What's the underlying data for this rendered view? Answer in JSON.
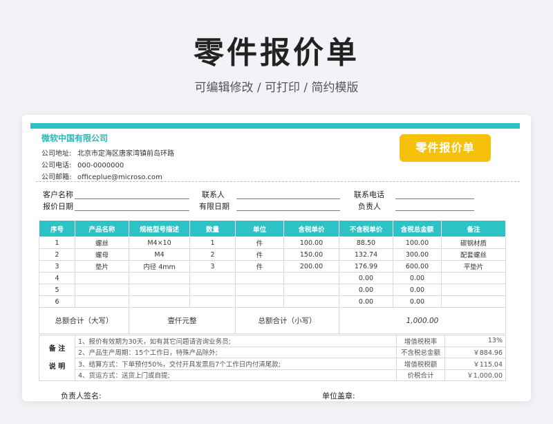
{
  "hero": {
    "title": "零件报价单",
    "subtitle": "可编辑修改 /  可打印  /  简约模版"
  },
  "company": {
    "name": "微软中国有限公司",
    "address_label": "公司地址:",
    "address": "北京市定海区唐家湾镇前岛环路",
    "phone_label": "公司电话:",
    "phone": "000-0000000",
    "email_label": "公司邮箱:",
    "email": "officeplue@microso.com"
  },
  "badge": "零件报价单",
  "fields": {
    "customer": "客户名称",
    "contact": "联系人",
    "contact_phone": "联系电话",
    "quote_date": "报价日期",
    "valid_date": "有限日期",
    "manager": "负责人"
  },
  "table": {
    "headers": [
      "序号",
      "产品名称",
      "规格型号描述",
      "数量",
      "单位",
      "含税单价",
      "不含税单价",
      "含税总金额",
      "备注"
    ],
    "rows": [
      [
        "1",
        "螺丝",
        "M4×10",
        "1",
        "件",
        "100.00",
        "88.50",
        "100.00",
        "碳钢材质"
      ],
      [
        "2",
        "螺母",
        "M4",
        "2",
        "件",
        "150.00",
        "132.74",
        "300.00",
        "配套螺丝"
      ],
      [
        "3",
        "垫片",
        "内径 4mm",
        "3",
        "件",
        "200.00",
        "176.99",
        "600.00",
        "平垫片"
      ],
      [
        "4",
        "",
        "",
        "",
        "",
        "",
        "0.00",
        "0.00",
        ""
      ],
      [
        "5",
        "",
        "",
        "",
        "",
        "",
        "0.00",
        "0.00",
        ""
      ],
      [
        "6",
        "",
        "",
        "",
        "",
        "",
        "0.00",
        "0.00",
        ""
      ]
    ],
    "total_upper_label": "总额合计（大写）",
    "total_upper_value": "壹仟元整",
    "total_lower_label": "总额合计（小写）",
    "total_lower_value": "1,000.00"
  },
  "notes": {
    "side_label_1": "备 注",
    "side_label_2": "说 明",
    "items": [
      {
        "text": "1、报价有效期为30天，如有其它问题请咨询业务员;",
        "label": "增值税税率",
        "value": "13%"
      },
      {
        "text": "2、产品生产周期：15个工作日，特殊产品除外;",
        "label": "不含税总金额",
        "value": "￥884.96"
      },
      {
        "text": "3、结算方式：下单预付50%，交付开具发票后7个工作日内付清尾款;",
        "label": "增值税税额",
        "value": "￥115.04"
      },
      {
        "text": "4、货运方式：送货上门或自提;",
        "label": "价税合计",
        "value": "￥1,000.00"
      }
    ]
  },
  "sign": {
    "manager": "负责人签名:",
    "seal": "单位盖章:"
  },
  "colors": {
    "accent": "#2cc3c6",
    "badge": "#f6c10d",
    "total_red": "#e02020"
  }
}
